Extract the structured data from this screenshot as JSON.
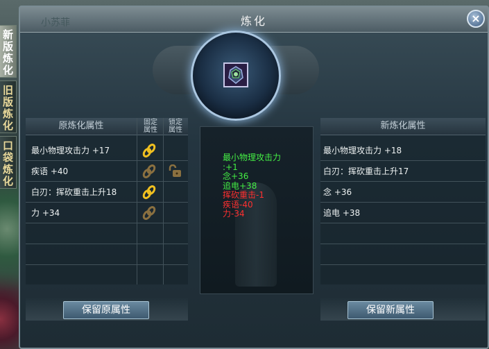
{
  "window": {
    "title": "炼化",
    "ghost_label": "小苏菲",
    "close_label": "×"
  },
  "side_tabs": [
    {
      "label_lines": [
        "新",
        "版",
        "炼",
        "化"
      ],
      "active": true
    },
    {
      "label_lines": [
        "旧",
        "版",
        "炼",
        "化"
      ],
      "active": false
    },
    {
      "label_lines": [
        "口",
        "袋",
        "炼",
        "化"
      ],
      "active": false
    }
  ],
  "original": {
    "header": "原炼化属性",
    "fixed_header_lines": [
      "固定",
      "属性"
    ],
    "lock_header_lines": [
      "锁定",
      "属性"
    ],
    "rows": [
      {
        "text": "最小物理攻击力 +17",
        "chain_icon": "chain-gold-icon",
        "lock_icon": ""
      },
      {
        "text": "疾语 +40",
        "chain_icon": "chain-bronze-icon",
        "lock_icon": "padlock-open-icon"
      },
      {
        "text": "白刃：挥砍重击上升18",
        "chain_icon": "chain-gold-icon",
        "lock_icon": ""
      },
      {
        "text": "力 +34",
        "chain_icon": "chain-bronze-icon",
        "lock_icon": ""
      },
      {
        "text": "",
        "chain_icon": "",
        "lock_icon": ""
      },
      {
        "text": "",
        "chain_icon": "",
        "lock_icon": ""
      }
    ],
    "button_label": "保留原属性"
  },
  "preview": {
    "lines": [
      {
        "text": "最小物理攻击力",
        "color": "green"
      },
      {
        "text": ":+1",
        "color": "green"
      },
      {
        "text": "念+36",
        "color": "green"
      },
      {
        "text": "追电+38",
        "color": "green"
      },
      {
        "text": "挥砍重击-1",
        "color": "red"
      },
      {
        "text": "疾语-40",
        "color": "red"
      },
      {
        "text": "力-34",
        "color": "red"
      }
    ]
  },
  "new": {
    "header": "新炼化属性",
    "rows": [
      {
        "text": "最小物理攻击力 +18"
      },
      {
        "text": "白刃：挥砍重击上升17"
      },
      {
        "text": "念 +36"
      },
      {
        "text": "追电 +38"
      },
      {
        "text": ""
      },
      {
        "text": ""
      }
    ],
    "button_label": "保留新属性"
  },
  "item": {
    "icon": "armor-item-icon"
  },
  "colors": {
    "gain": "#44ee44",
    "loss": "#ff3030",
    "chain_gold": "#f0c020",
    "chain_bronze": "#8a7040"
  }
}
